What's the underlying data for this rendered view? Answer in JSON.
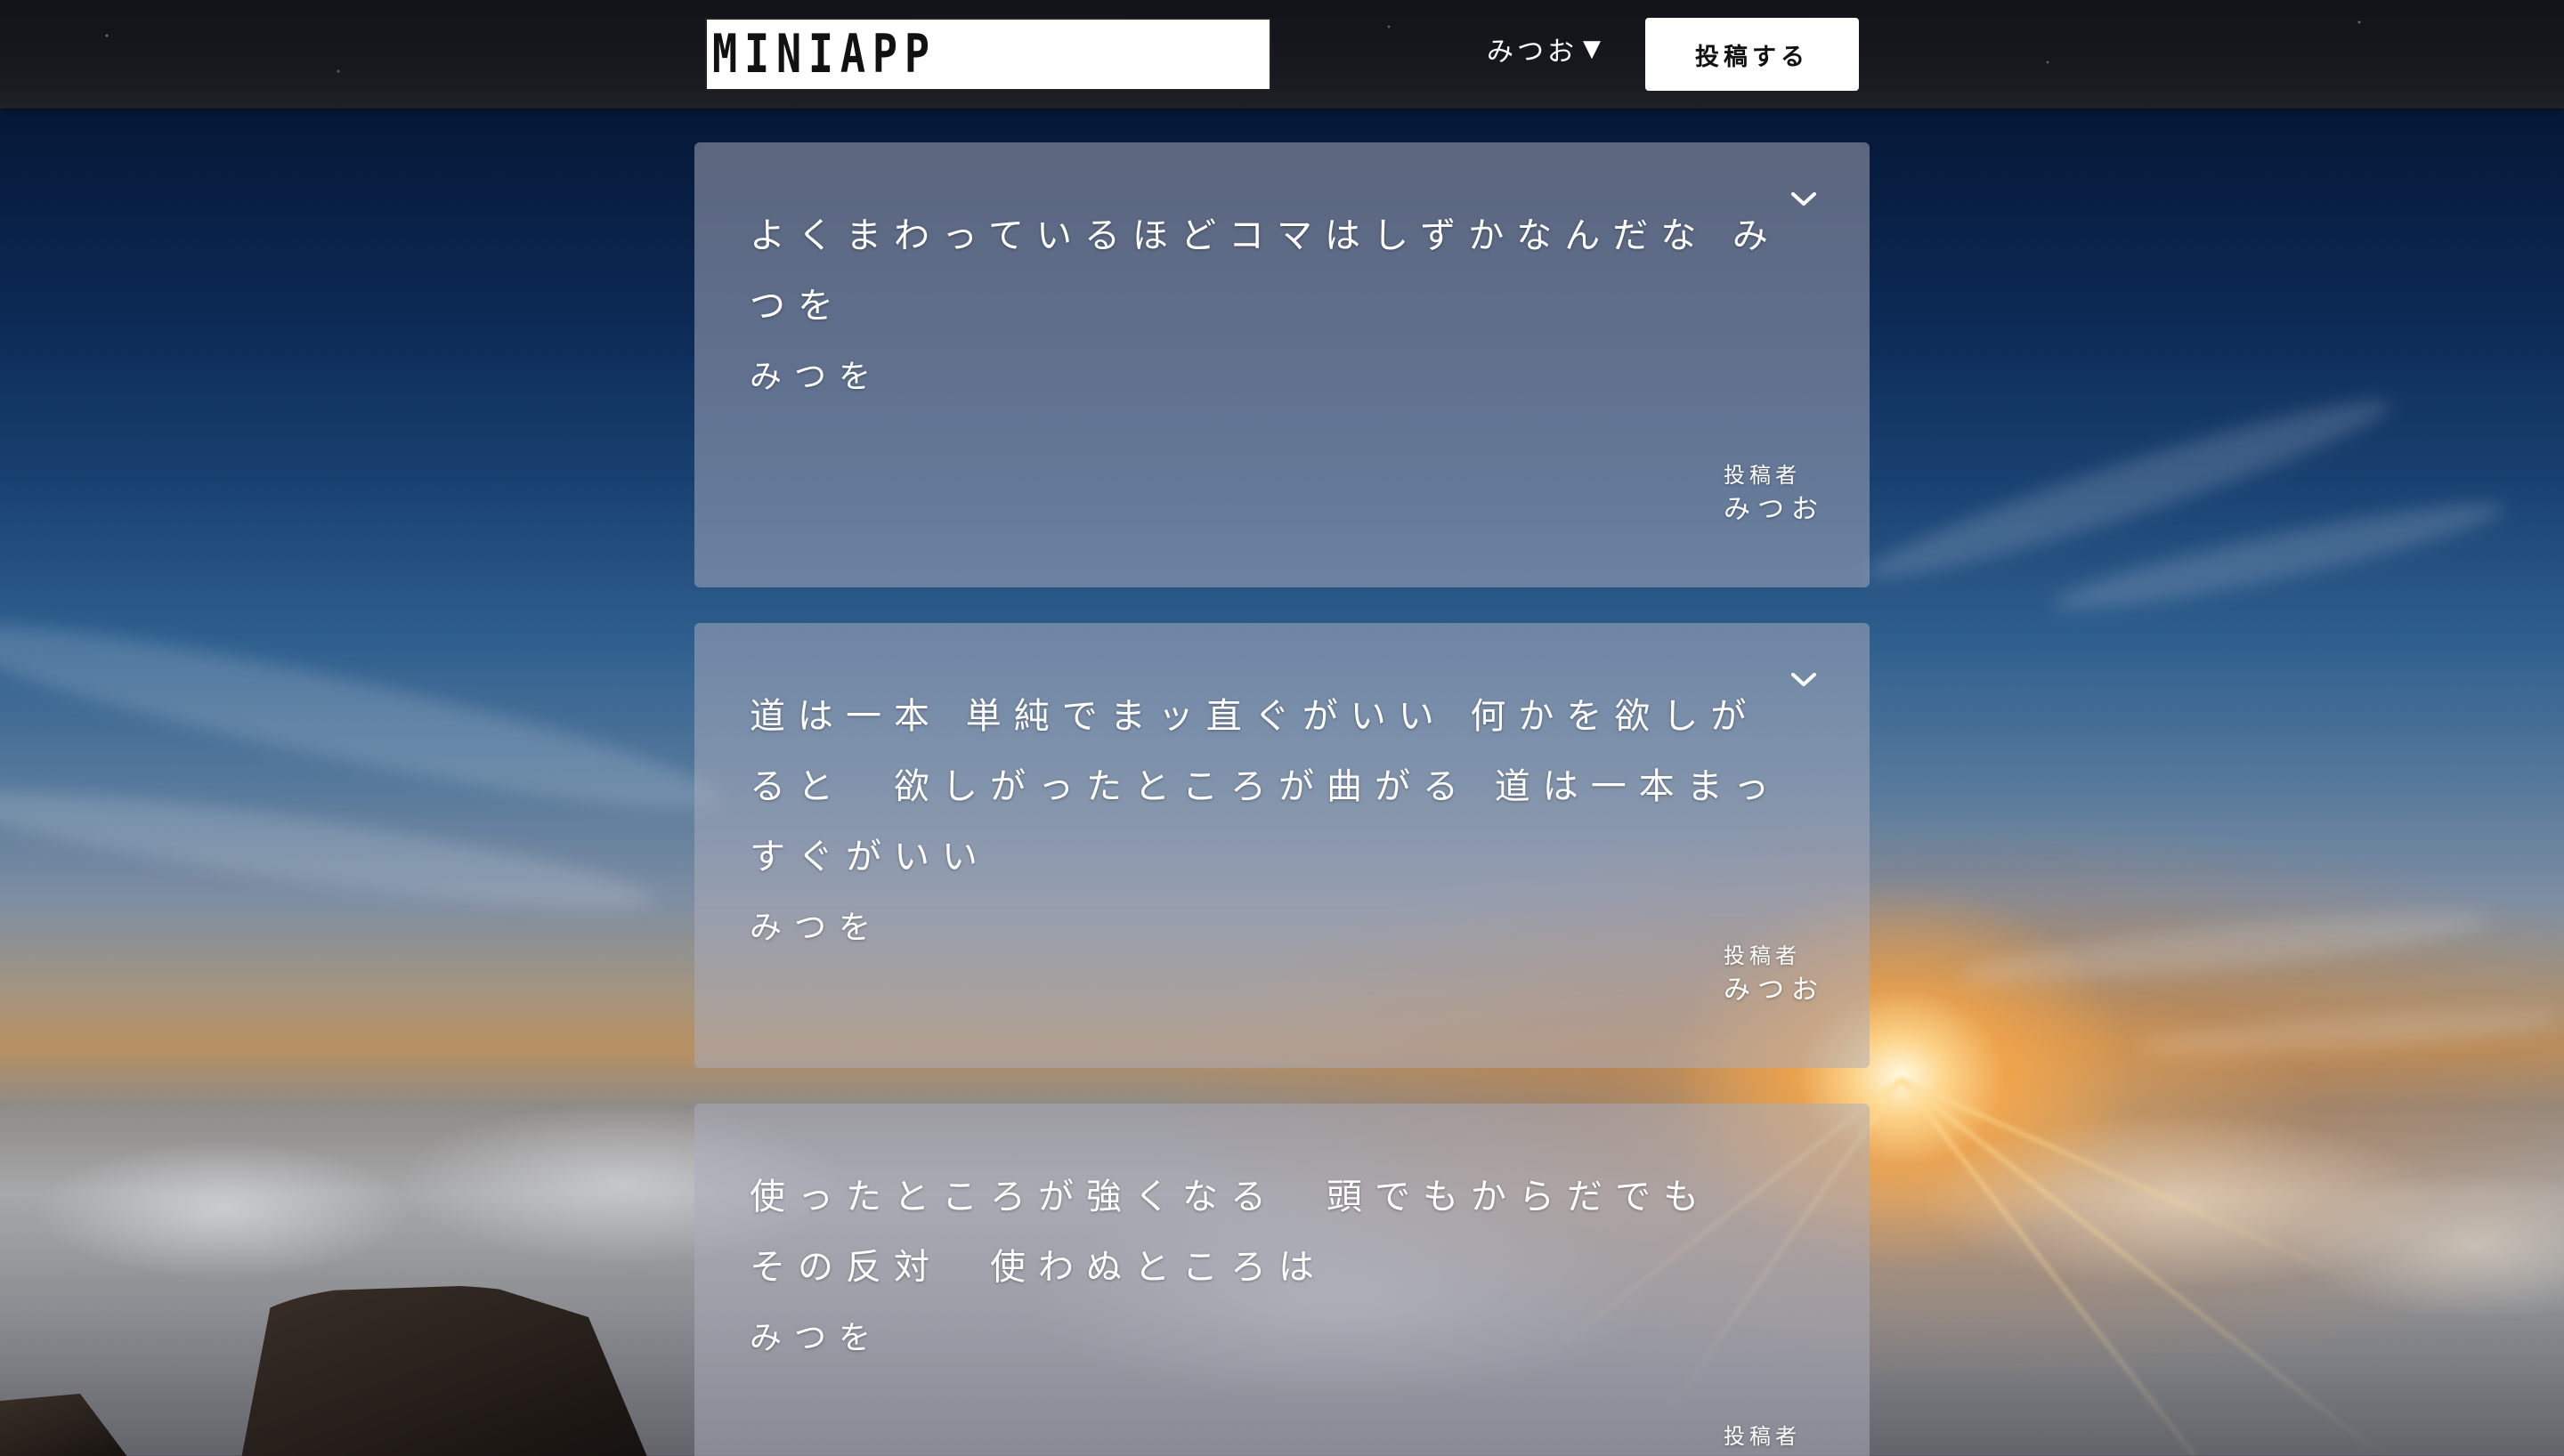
{
  "header": {
    "logo_text": "MINIAPP",
    "user_name": "みつお",
    "user_caret": "▼",
    "post_button_label": "投稿する"
  },
  "posts": [
    {
      "body": "よくまわっているほどコマはしずかなんだな みつを",
      "author_inline": "みつを",
      "poster_label": "投稿者",
      "poster_name": "みつお",
      "menu_icon": "chevron-down-icon"
    },
    {
      "body": "道は一本 単純でまッ直ぐがいい 何かを欲しがると　欲しがったところが曲がる 道は一本まっすぐがいい",
      "author_inline": "みつを",
      "poster_label": "投稿者",
      "poster_name": "みつお",
      "menu_icon": "chevron-down-icon"
    },
    {
      "body": "使ったところが強くなる　頭でもからだでも その反対　使わぬところは",
      "author_inline": "みつを",
      "poster_label": "投稿者",
      "poster_name": "",
      "menu_icon": ""
    }
  ],
  "colors": {
    "header_bg": "#17181d",
    "card_bg": "rgba(170,172,188,0.52)",
    "text": "#ffffff"
  }
}
